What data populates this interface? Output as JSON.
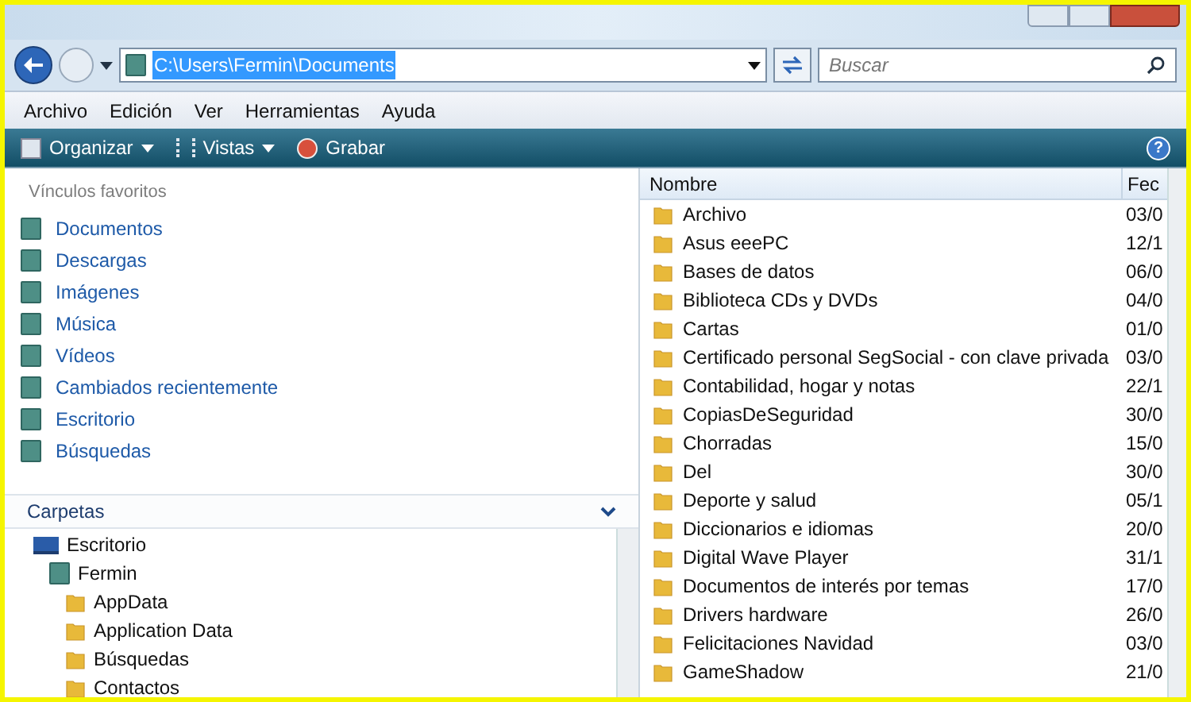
{
  "address_bar": {
    "path": "C:\\Users\\Fermin\\Documents",
    "selected": true
  },
  "search": {
    "placeholder": "Buscar"
  },
  "help": "?",
  "menu": [
    "Archivo",
    "Edición",
    "Ver",
    "Herramientas",
    "Ayuda"
  ],
  "toolbar": [
    {
      "label": "Organizar",
      "kind": "menu"
    },
    {
      "label": "Vistas",
      "kind": "menu"
    },
    {
      "label": "Grabar",
      "kind": "button"
    }
  ],
  "favorites": {
    "title": "Vínculos favoritos",
    "items": [
      "Documentos",
      "Descargas",
      "Imágenes",
      "Música",
      "Vídeos",
      "Cambiados recientemente",
      "Escritorio",
      "Búsquedas"
    ]
  },
  "folders": {
    "title": "Carpetas",
    "tree": [
      {
        "label": "Escritorio",
        "children": [
          {
            "label": "Fermin",
            "children": [
              {
                "label": "AppData"
              },
              {
                "label": "Application Data"
              },
              {
                "label": "Búsquedas"
              },
              {
                "label": "Contactos"
              }
            ]
          }
        ]
      }
    ]
  },
  "file_list": {
    "columns": [
      "Nombre",
      "Fec"
    ],
    "rows": [
      {
        "name": "Archivo",
        "date": "03/0"
      },
      {
        "name": "Asus eeePC",
        "date": "12/1"
      },
      {
        "name": "Bases de datos",
        "date": "06/0"
      },
      {
        "name": "Biblioteca CDs y DVDs",
        "date": "04/0"
      },
      {
        "name": "Cartas",
        "date": "01/0"
      },
      {
        "name": "Certificado personal SegSocial - con clave privada",
        "date": "03/0"
      },
      {
        "name": "Contabilidad, hogar y notas",
        "date": "22/1"
      },
      {
        "name": "CopiasDeSeguridad",
        "date": "30/0"
      },
      {
        "name": "Chorradas",
        "date": "15/0"
      },
      {
        "name": "Del",
        "date": "30/0"
      },
      {
        "name": "Deporte y salud",
        "date": "05/1"
      },
      {
        "name": "Diccionarios e idiomas",
        "date": "20/0"
      },
      {
        "name": "Digital Wave Player",
        "date": "31/1"
      },
      {
        "name": "Documentos de interés por temas",
        "date": "17/0"
      },
      {
        "name": "Drivers hardware",
        "date": "26/0"
      },
      {
        "name": "Felicitaciones Navidad",
        "date": "03/0"
      },
      {
        "name": "GameShadow",
        "date": "21/0"
      }
    ]
  }
}
